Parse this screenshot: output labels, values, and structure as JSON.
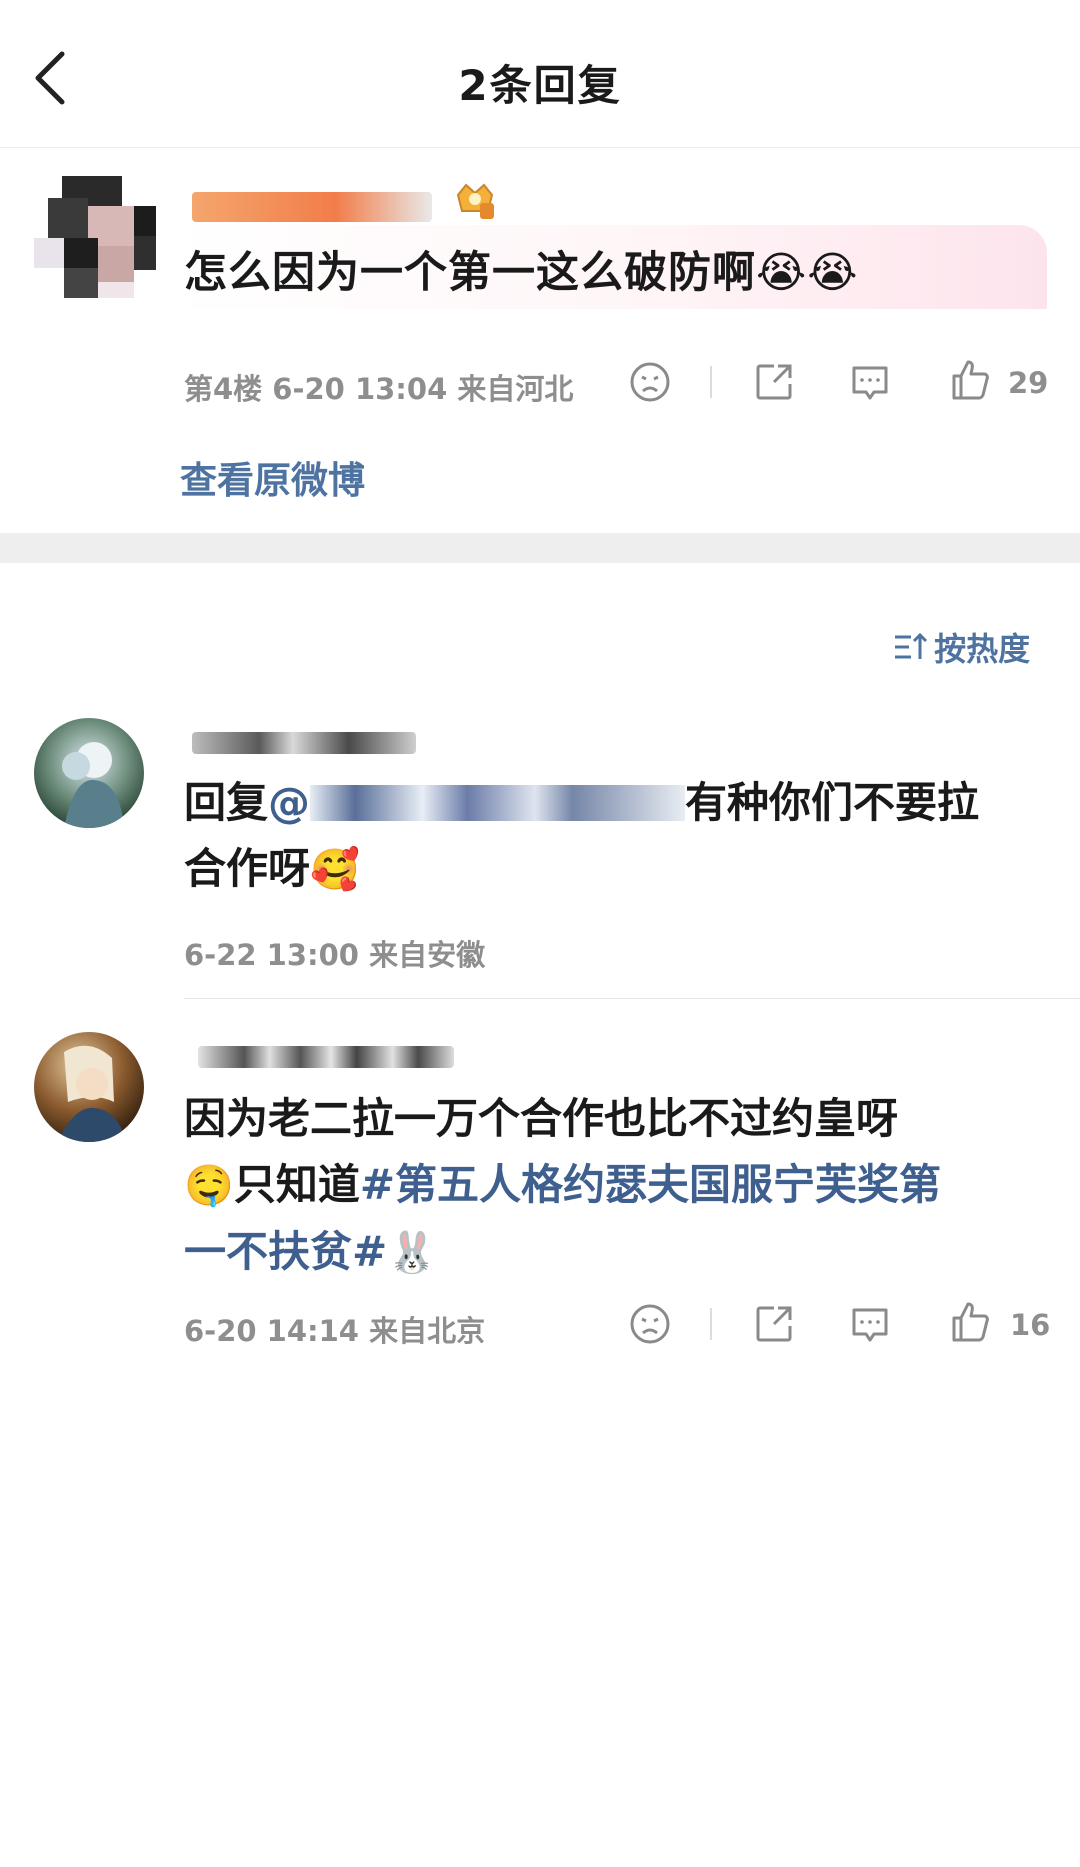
{
  "header": {
    "title": "2条回复"
  },
  "original_comment": {
    "text": "怎么因为一个第一这么破防啊😭😭",
    "floor_time_location": "第4楼 6-20 13:04 来自河北",
    "like_count": "29",
    "view_original_label": "查看原微博"
  },
  "sort": {
    "label": "按热度"
  },
  "replies": [
    {
      "prefix": "回复",
      "mention": "@",
      "text_after_mention": "有种你们不要拉",
      "text_line2": "合作呀",
      "emoji": "🥰",
      "time_location": "6-22 13:00 来自安徽"
    },
    {
      "text_line1": "因为老二拉一万个合作也比不过约皇呀",
      "emoji1": "🤤",
      "text_line2_prefix": "只知道",
      "topic_part1": "#第五人格约瑟夫国服宁芙奖第",
      "topic_part2": "一不扶贫#",
      "emoji2": "🐰",
      "time_location": "6-20 14:14 来自北京",
      "like_count": "16"
    }
  ],
  "icons": {
    "back": "chevron-left-icon",
    "dislike": "sad-face-icon",
    "share": "share-icon",
    "comment": "comment-icon",
    "like": "thumbs-up-icon",
    "sort": "sort-icon"
  },
  "colors": {
    "link": "#4e73a0",
    "topic": "#3f5f8f",
    "meta": "#8e8e8e"
  }
}
